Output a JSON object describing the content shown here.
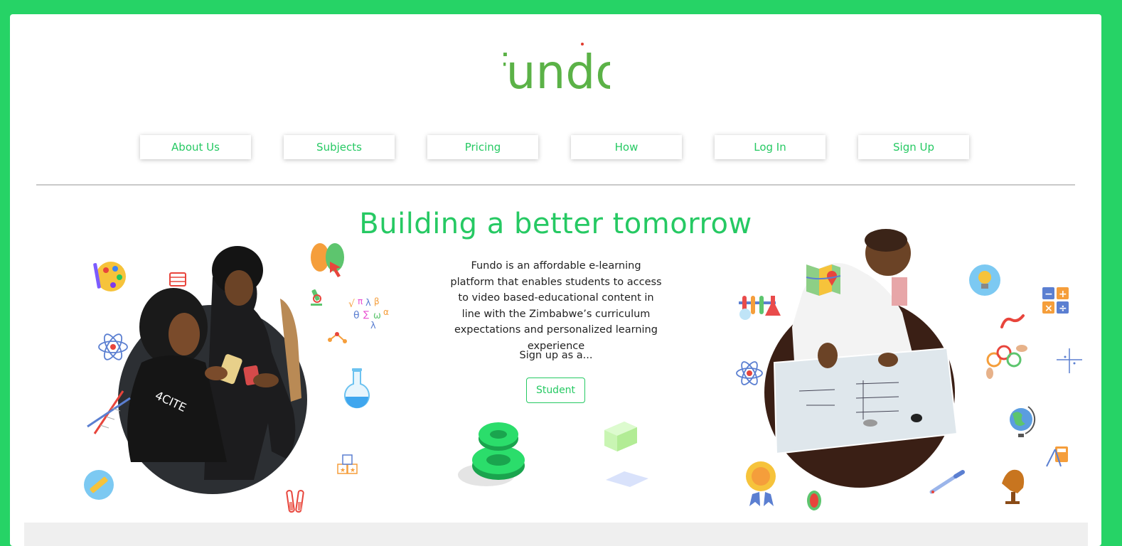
{
  "logo": {
    "text": "fundo",
    "color": "#5bb247"
  },
  "nav": {
    "items": [
      {
        "label": "About Us"
      },
      {
        "label": "Subjects"
      },
      {
        "label": "Pricing"
      },
      {
        "label": "How"
      },
      {
        "label": "Log In"
      },
      {
        "label": "Sign Up"
      }
    ]
  },
  "hero": {
    "title": "Building a better tomorrow",
    "description": "Fundo is an affordable e-learning platform that enables students to access to video based-educational content in line with the Zimbabwe’s curriculum expectations and personalized learning experience",
    "signup_prompt": "Sign up as a...",
    "student_button": "Student"
  },
  "colors": {
    "page_background": "#26d366",
    "accent": "#26c963",
    "logo_green": "#5bb247",
    "footer_band": "#efefef"
  }
}
